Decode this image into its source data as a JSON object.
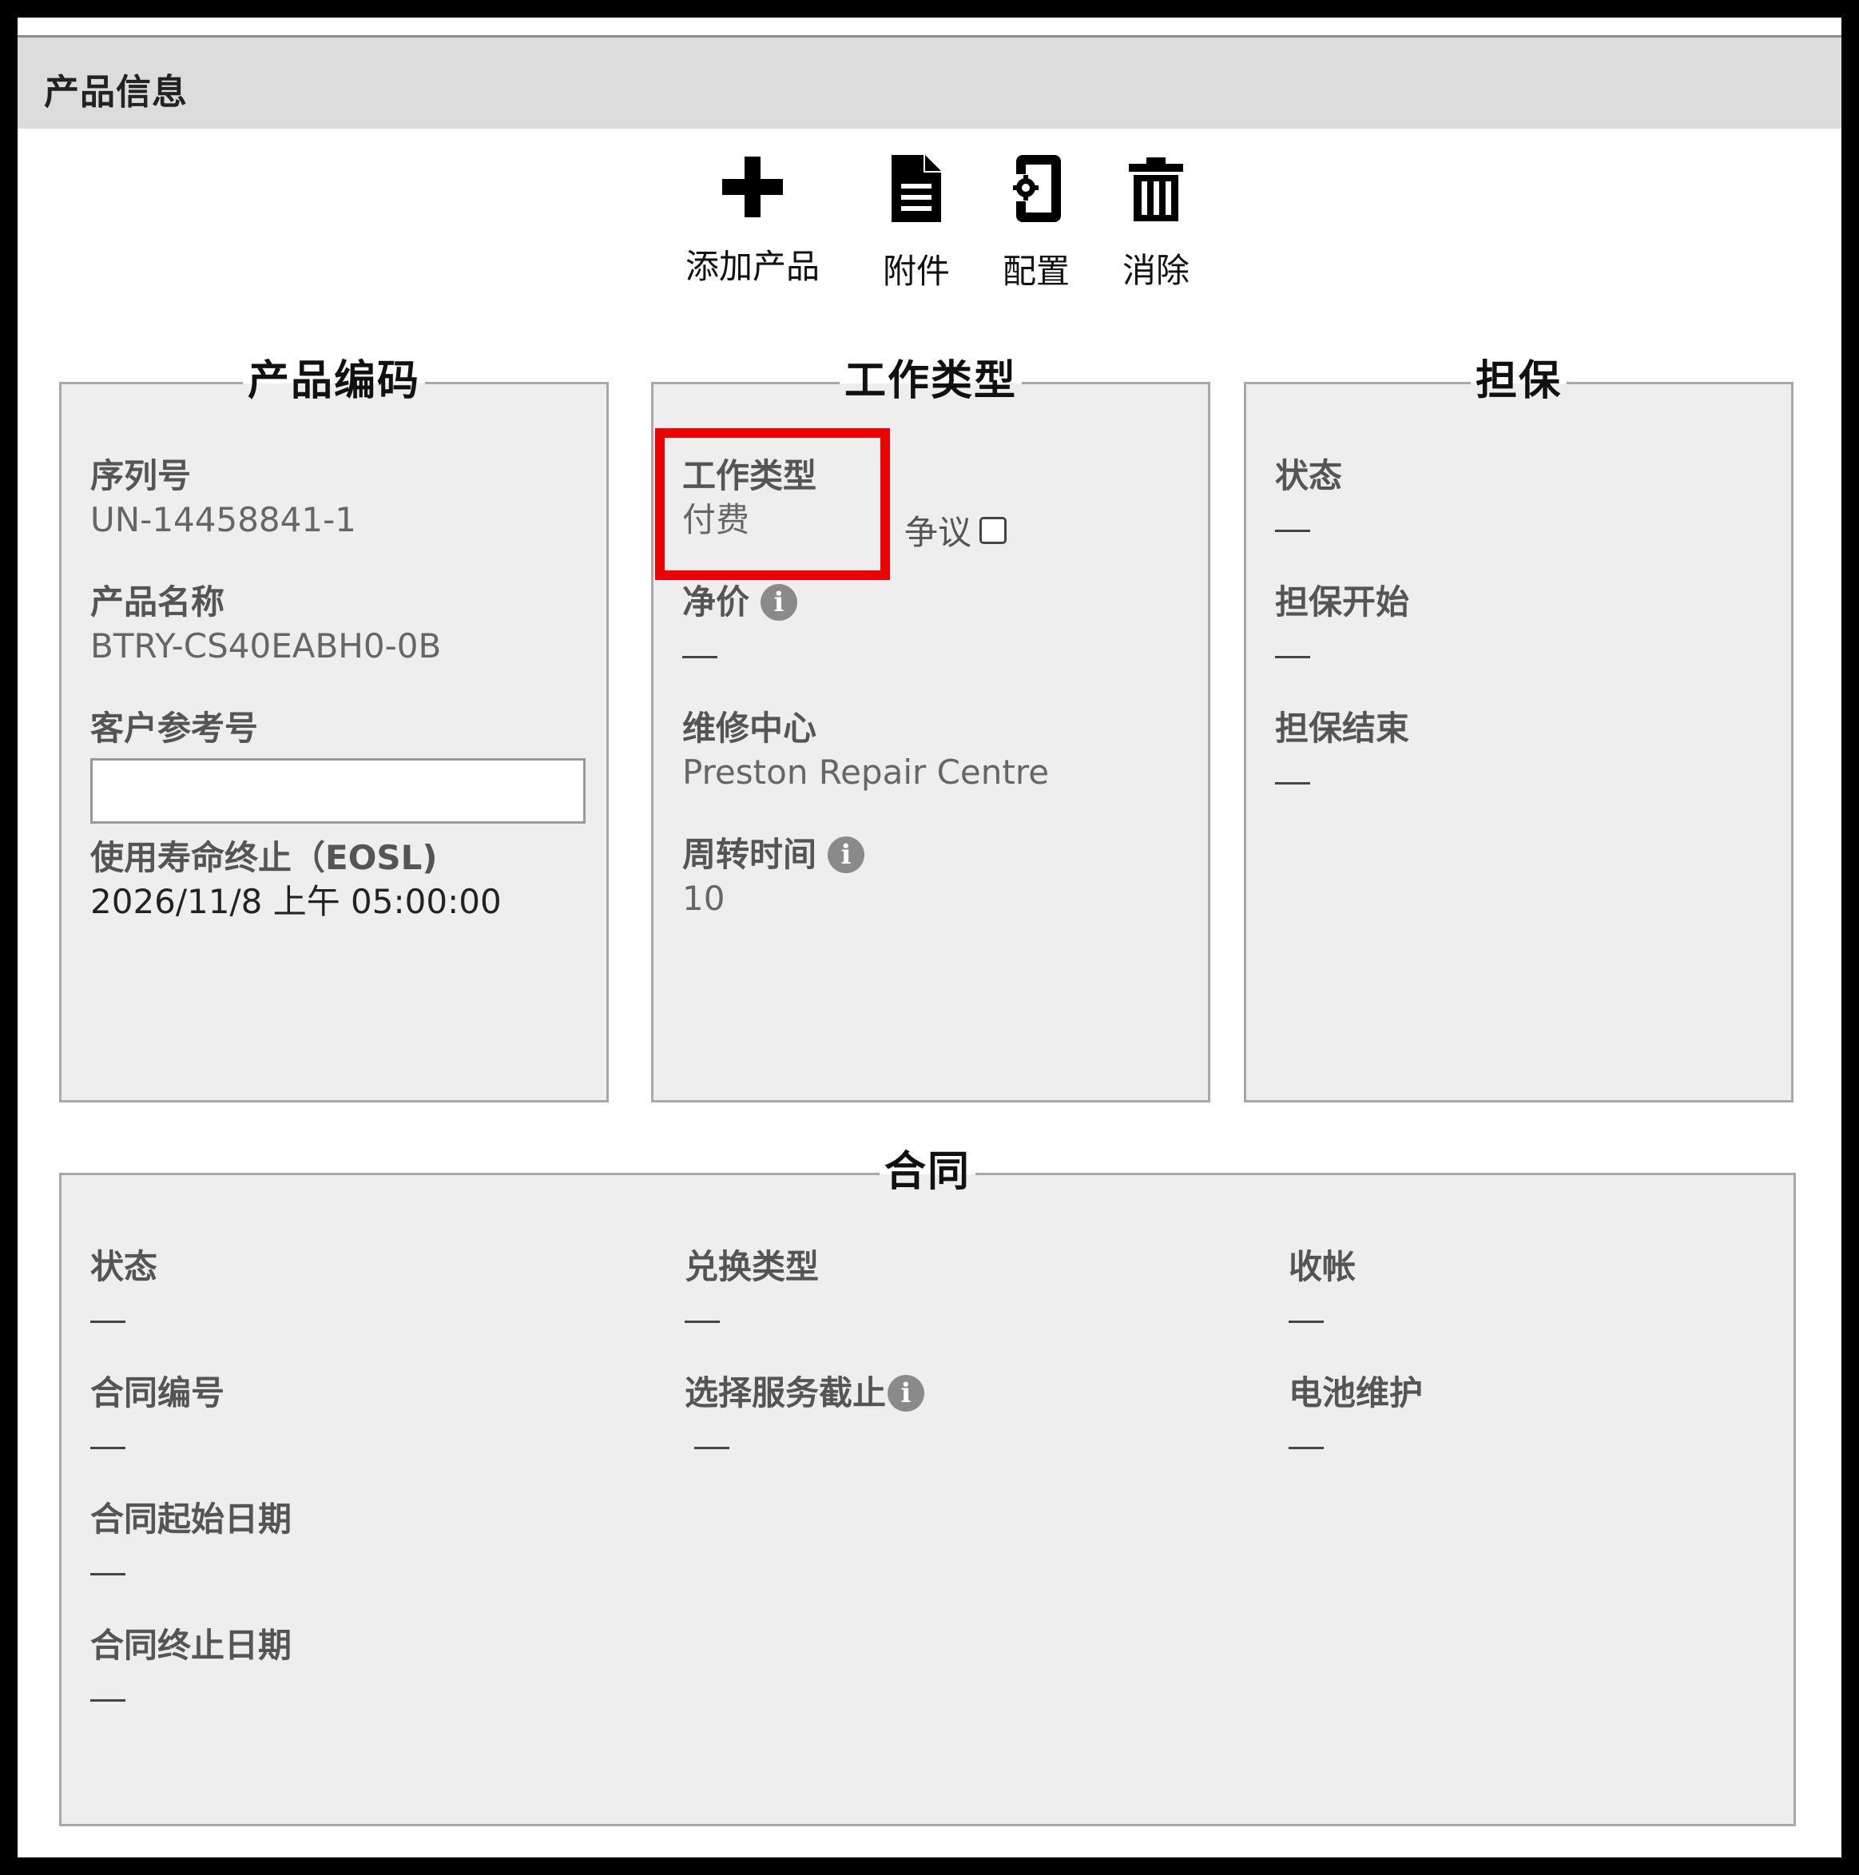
{
  "header": {
    "title": "产品信息"
  },
  "toolbar": {
    "add_product": {
      "label": "添加产品",
      "icon": "plus-icon"
    },
    "attachment": {
      "label": "附件",
      "icon": "document-icon"
    },
    "configure": {
      "label": "配置",
      "icon": "device-config-icon"
    },
    "delete": {
      "label": "消除",
      "icon": "trash-icon"
    }
  },
  "product_code": {
    "title": "产品编码",
    "serial_label": "序列号",
    "serial_value": "UN-14458841-1",
    "name_label": "产品名称",
    "name_value": "BTRY-CS40EABH0-0B",
    "customer_ref_label": "客户参考号",
    "customer_ref_value": "",
    "eosl_label": "使用寿命终止（EOSL)",
    "eosl_value": "2026/11/8 上午 05:00:00"
  },
  "work_type": {
    "title": "工作类型",
    "type_label": "工作类型",
    "type_value": "付费",
    "dispute_label": "争议",
    "dispute_checked": false,
    "net_price_label": "净价",
    "net_price_value": "—",
    "repair_center_label": "维修中心",
    "repair_center_value": "Preston Repair Centre",
    "turnaround_label": "周转时间",
    "turnaround_value": "10",
    "highlight_color": "#ee0000"
  },
  "warranty": {
    "title": "担保",
    "status_label": "状态",
    "status_value": "—",
    "start_label": "担保开始",
    "start_value": "—",
    "end_label": "担保结束",
    "end_value": "—"
  },
  "contract": {
    "title": "合同",
    "status_label": "状态",
    "status_value": "—",
    "number_label": "合同编号",
    "number_value": "—",
    "start_label": "合同起始日期",
    "start_value": "—",
    "end_label": "合同终止日期",
    "end_value": "—",
    "exchange_type_label": "兑换类型",
    "exchange_type_value": "—",
    "service_cutoff_label": "选择服务截止",
    "service_cutoff_value": "—",
    "billing_label": "收帐",
    "billing_value": "—",
    "battery_label": "电池维护",
    "battery_value": "—"
  }
}
